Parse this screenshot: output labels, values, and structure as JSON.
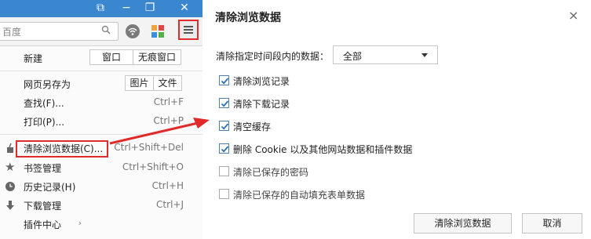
{
  "browser": {
    "address_placeholder": "百度",
    "menu": {
      "new_label": "新建",
      "new_window": "窗口",
      "new_incognito": "无痕窗口",
      "save_as": "网页另存为",
      "save_image": "图片",
      "save_file": "文件",
      "find": "查找(F)...",
      "find_shortcut": "Ctrl+F",
      "print": "打印(P)...",
      "print_shortcut": "Ctrl+P",
      "clear_data": "清除浏览数据(C)...",
      "clear_shortcut": "Ctrl+Shift+Del",
      "bookmarks": "书签管理",
      "bookmarks_shortcut": "Ctrl+Shift+O",
      "history": "历史记录(H)",
      "history_shortcut": "Ctrl+H",
      "downloads": "下载管理",
      "downloads_shortcut": "Ctrl+J",
      "plugins": "插件中心"
    }
  },
  "dialog": {
    "title": "清除浏览数据",
    "close": "×",
    "range_label": "清除指定时间段内的数据：",
    "range_value": "全部",
    "options": [
      {
        "label": "清除浏览记录",
        "checked": true
      },
      {
        "label": "清除下载记录",
        "checked": true
      },
      {
        "label": "清空缓存",
        "checked": true
      },
      {
        "label": "删除 Cookie 以及其他网站数据和插件数据",
        "checked": true
      },
      {
        "label": "清除已保存的密码",
        "checked": false
      },
      {
        "label": "清除已保存的自动填充表单数据",
        "checked": false
      }
    ],
    "confirm_button": "清除浏览数据",
    "cancel_button": "取消"
  },
  "colors": {
    "titlebar": "#3a86cf",
    "highlight": "#e02b2b",
    "check": "#2f6fb6"
  }
}
